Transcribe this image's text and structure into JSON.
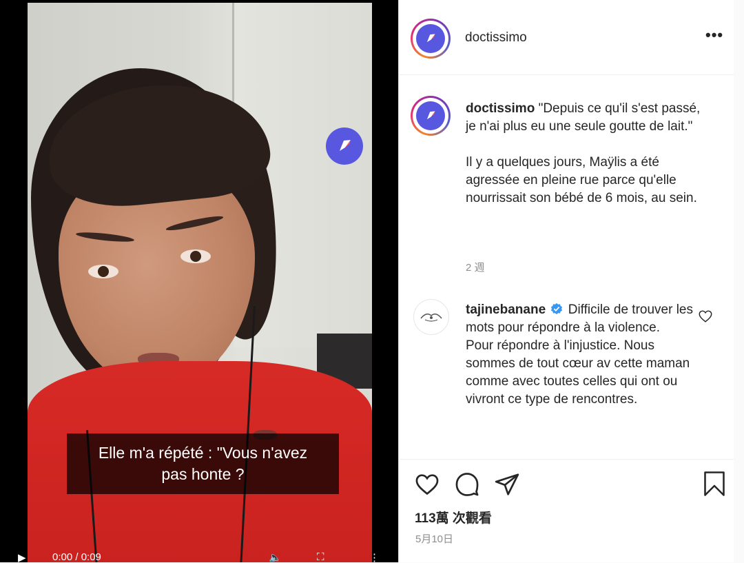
{
  "video": {
    "subtitle_line1": "Elle m'a répété : \"Vous n'avez",
    "subtitle_line2": "pas honte ?",
    "time_display": "0:00 / 0:09"
  },
  "post": {
    "username": "doctissimo",
    "more_label": "•••",
    "caption_quote": "\"Depuis ce qu'il s'est passé, je n'ai plus eu une seule goutte de lait.\"",
    "caption_body": "Il y a quelques jours, Maÿlis a été agressée en pleine rue parce qu'elle nourrissait son bébé de 6 mois, au sein.",
    "caption_time": "2 週",
    "comment": {
      "username": "tajinebanane",
      "text_line1": "Difficile de trouver les mots pour répondre à la violence.",
      "text_line2": "Pour répondre à l'injustice. Nous sommes de tout cœur av cette maman comme avec toutes celles qui ont ou vivront ce type de rencontres."
    },
    "views": "113萬 次觀看",
    "date": "5月10日"
  },
  "colors": {
    "brand_purple": "#5757e0",
    "verified_blue": "#3897f0",
    "shirt_red": "#d72a26"
  },
  "icons": [
    "logo-icon",
    "more-icon",
    "verified-icon",
    "heart-icon",
    "comment-icon",
    "share-icon",
    "bookmark-icon"
  ]
}
